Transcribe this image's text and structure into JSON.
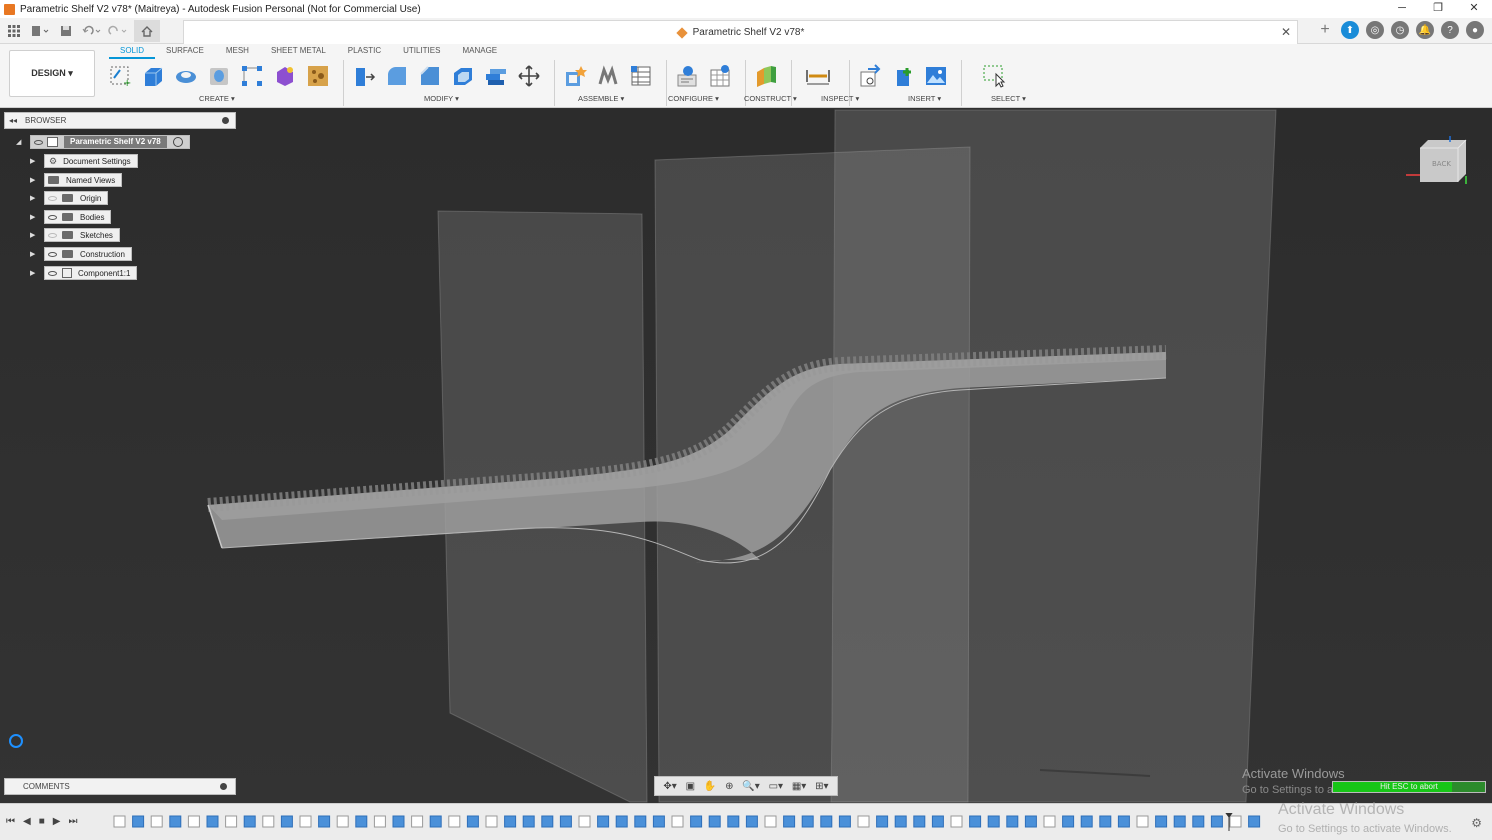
{
  "window": {
    "title": "Parametric Shelf V2 v78* (Maitreya) - Autodesk Fusion Personal (Not for Commercial Use)",
    "controls": [
      "─",
      "❐",
      "✕"
    ]
  },
  "document_tab": {
    "title": "Parametric Shelf V2 v78*",
    "close": "✕"
  },
  "ribbon": {
    "workspace": "DESIGN ▾",
    "tabs": [
      "SOLID",
      "SURFACE",
      "MESH",
      "SHEET METAL",
      "PLASTIC",
      "UTILITIES",
      "MANAGE"
    ],
    "active_tab": "SOLID",
    "groups": {
      "create": "CREATE ▾",
      "modify": "MODIFY ▾",
      "assemble": "ASSEMBLE ▾",
      "configure": "CONFIGURE ▾",
      "construct": "CONSTRUCT ▾",
      "inspect": "INSPECT ▾",
      "insert": "INSERT ▾",
      "select": "SELECT ▾"
    }
  },
  "browser": {
    "title": "BROWSER",
    "root": "Parametric Shelf V2 v78",
    "items": [
      {
        "label": "Document Settings",
        "icon": "gear-icon",
        "visible": null
      },
      {
        "label": "Named Views",
        "icon": "folder-icon",
        "visible": null
      },
      {
        "label": "Origin",
        "icon": "folder-icon",
        "visible": false
      },
      {
        "label": "Bodies",
        "icon": "folder-icon",
        "visible": true
      },
      {
        "label": "Sketches",
        "icon": "folder-icon",
        "visible": false
      },
      {
        "label": "Construction",
        "icon": "folder-icon",
        "visible": true
      },
      {
        "label": "Component1:1",
        "icon": "component-icon",
        "visible": true
      }
    ]
  },
  "comments": {
    "title": "COMMENTS"
  },
  "viewcube": {
    "face": "BACK"
  },
  "watermark": {
    "line1": "Activate Windows",
    "line2": "Go to Settings to activate Windows."
  },
  "progress": {
    "label": "Hit ESC to abort",
    "fraction": 0.78
  },
  "colors": {
    "accent": "#0696d7",
    "viewport": "#303030",
    "progress": "#17c617"
  }
}
